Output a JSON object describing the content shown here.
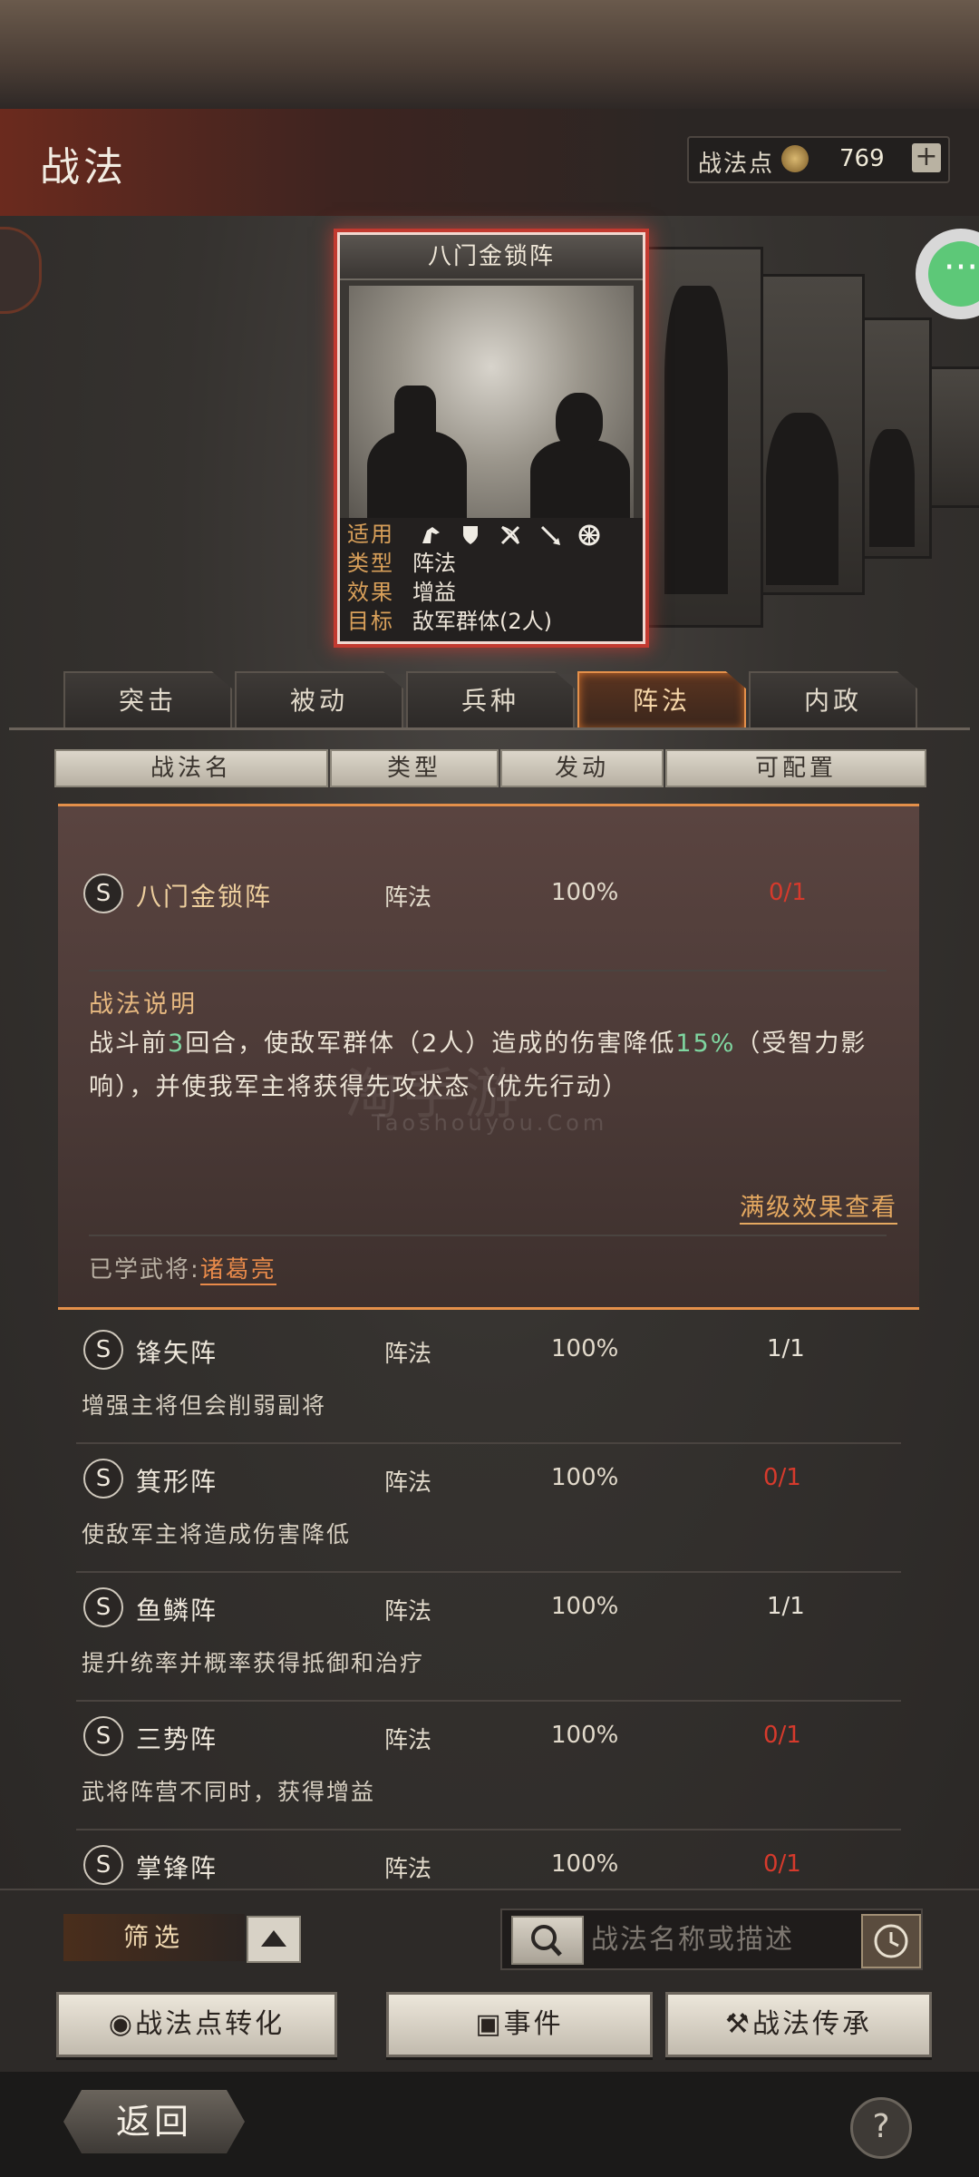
{
  "header": {
    "title": "战法",
    "points_label": "战法点",
    "points_value": "769",
    "add_label": "+"
  },
  "card": {
    "title": "八门金锁阵",
    "info": [
      {
        "key": "适用",
        "value": ""
      },
      {
        "key": "类型",
        "value": "阵法"
      },
      {
        "key": "效果",
        "value": "增益"
      },
      {
        "key": "目标",
        "value": "敌军群体(2人)"
      }
    ],
    "applicable_icons": [
      "cavalry-icon",
      "shield-icon",
      "bow-icon",
      "spear-icon",
      "wheel-icon"
    ]
  },
  "tabs": [
    {
      "label": "突击",
      "active": false
    },
    {
      "label": "被动",
      "active": false
    },
    {
      "label": "兵种",
      "active": false
    },
    {
      "label": "阵法",
      "active": true
    },
    {
      "label": "内政",
      "active": false
    }
  ],
  "columns": [
    "战法名",
    "类型",
    "发动",
    "可配置"
  ],
  "expanded": {
    "grade": "S",
    "name": "八门金锁阵",
    "type": "阵法",
    "rate": "100%",
    "config": "0/1",
    "desc_title": "战法说明",
    "desc_parts": [
      "战斗前",
      "3",
      "回合，使敌军群体（2人）造成的伤害降低",
      "15%",
      "（受智力影响），并使我军主将获得先攻状态（优先行动）"
    ],
    "full_effect_link": "满级效果查看",
    "learned_label": "已学武将:",
    "learned_general": "诸葛亮"
  },
  "rows": [
    {
      "grade": "S",
      "name": "锋矢阵",
      "type": "阵法",
      "rate": "100%",
      "config": "1/1",
      "config_red": false,
      "desc": "增强主将但会削弱副将"
    },
    {
      "grade": "S",
      "name": "箕形阵",
      "type": "阵法",
      "rate": "100%",
      "config": "0/1",
      "config_red": true,
      "desc": "使敌军主将造成伤害降低"
    },
    {
      "grade": "S",
      "name": "鱼鳞阵",
      "type": "阵法",
      "rate": "100%",
      "config": "1/1",
      "config_red": false,
      "desc": "提升统率并概率获得抵御和治疗"
    },
    {
      "grade": "S",
      "name": "三势阵",
      "type": "阵法",
      "rate": "100%",
      "config": "0/1",
      "config_red": true,
      "desc": "武将阵营不同时，获得增益"
    },
    {
      "grade": "S",
      "name": "掌锋阵",
      "type": "阵法",
      "rate": "100%",
      "config": "0/1",
      "config_red": true,
      "desc": ""
    }
  ],
  "watermark": {
    "main": "淘手游",
    "sub": "Taoshouyou.Com"
  },
  "bottom": {
    "filter_label": "筛选",
    "search_placeholder": "战法名称或描述",
    "convert_label": "战法点转化",
    "event_label": "事件",
    "inherit_label": "战法传承",
    "back_label": "返回",
    "help_label": "?"
  },
  "colors": {
    "accent": "#e4904a",
    "red": "#d63a2c",
    "highlight": "#7fd6a0",
    "link": "#e88a4a"
  }
}
